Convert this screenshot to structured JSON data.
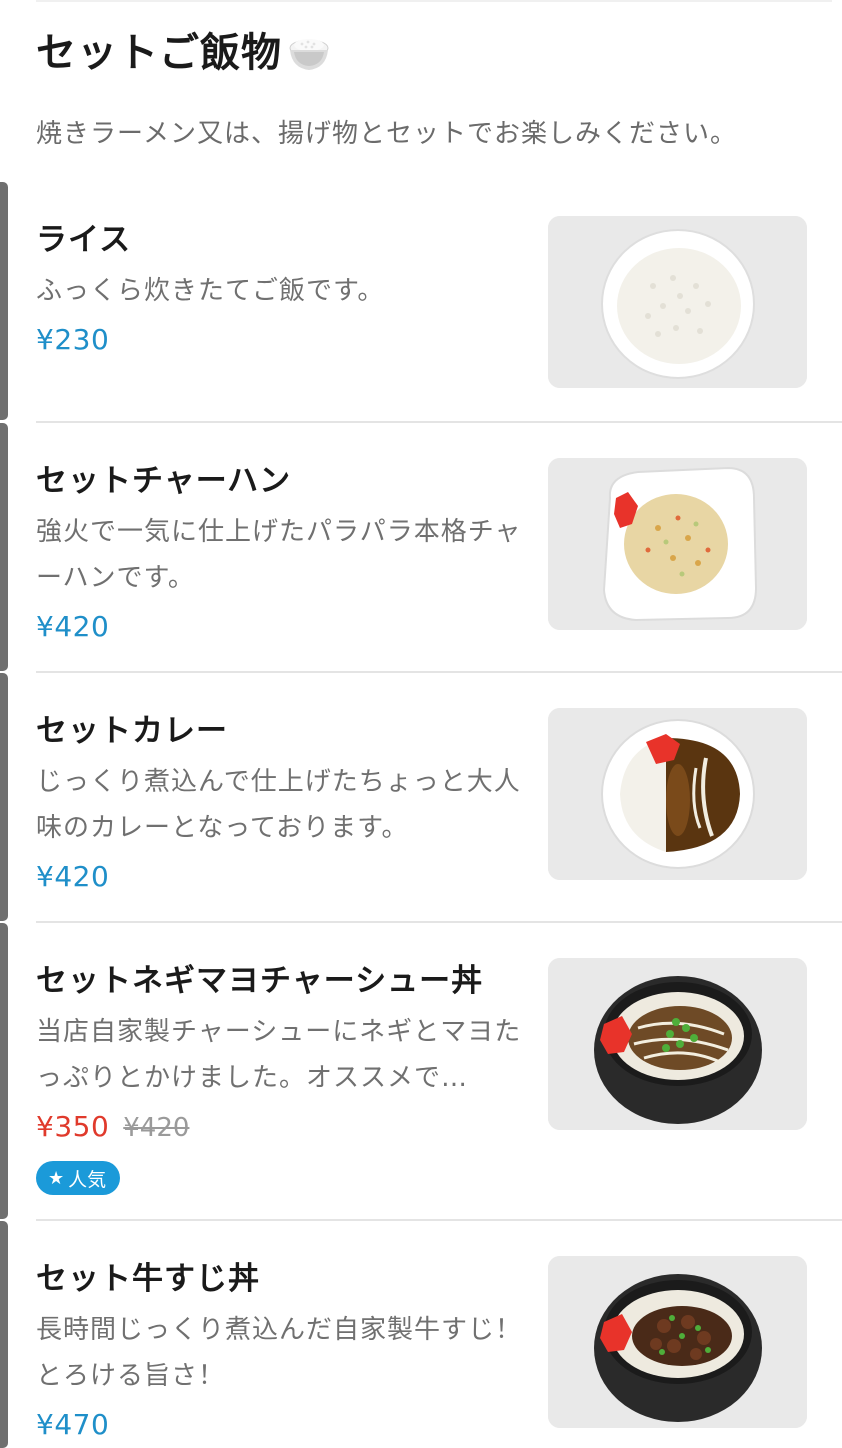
{
  "section": {
    "title": "セットご飯物",
    "title_icon": "rice-bowl-icon",
    "description": "焼きラーメン又は、揚げ物とセットでお楽しみください。"
  },
  "items": [
    {
      "name": "ライス",
      "description": "ふっくら炊きたてご飯です。",
      "price": "¥230",
      "image": "rice-bowl-photo"
    },
    {
      "name": "セットチャーハン",
      "description": "強火で一気に仕上げたパラパラ本格チャーハンです。",
      "price": "¥420",
      "image": "fried-rice-photo"
    },
    {
      "name": "セットカレー",
      "description": "じっくり煮込んで仕上げたちょっと大人味のカレーとなっております。",
      "price": "¥420",
      "image": "curry-rice-photo"
    },
    {
      "name": "セットネギマヨチャーシュー丼",
      "description": "当店自家製チャーシューにネギとマヨたっぷりとかけました。オススメで…",
      "price": "¥350",
      "original_price": "¥420",
      "badge": "人気",
      "badge_icon": "star-icon",
      "image": "chashu-don-photo"
    },
    {
      "name": "セット牛すじ丼",
      "description": "長時間じっくり煮込んだ自家製牛すじ！とろける旨さ！",
      "price": "¥470",
      "image": "gyusuji-don-photo"
    }
  ],
  "colors": {
    "price": "#1f8fc9",
    "sale_price": "#e03a2c",
    "badge": "#1b9ad9"
  }
}
